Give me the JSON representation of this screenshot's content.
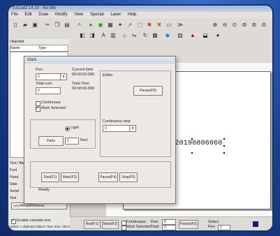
{
  "window": {
    "title": "EzCad2.14.10 - No title"
  },
  "menu": [
    "File",
    "Edit",
    "Draw",
    "Modify",
    "View",
    "Special",
    "Laser",
    "Help"
  ],
  "left_panel": {
    "header": "Objectlist",
    "col_name": "Name",
    "col_type": "Type",
    "lower_rows": [
      "Text / Barcode",
      "Font",
      "Fixed",
      "Date",
      "Serial",
      "Text"
    ],
    "text_value": "yyyyMMddHHmmss",
    "enable_variable_text": "Enable variable text",
    "status": "Select: 1 object(s) Object: Text, Size: X50.00 Y4.00"
  },
  "dialog": {
    "title": "Mark",
    "pen_label": "Pen",
    "pen_value": "0",
    "total_num_label": "Total num",
    "total_num_value": "0",
    "current_time_label": "Current time",
    "current_time_value": "00:00:00.000",
    "total_time_label": "Total Time",
    "total_time_value": "00:00:00.000",
    "continuous_label": "Continuous",
    "mark_selected_label": "Mark Selected",
    "red_label": "Red",
    "red_value": "",
    "light_label": "Light",
    "parts_label": "Parts",
    "parts_value": "1",
    "editor_label": "Editor",
    "param_button": "Param(F3)",
    "continuous_step_label": "Continuous step",
    "continuous_step_value": "0",
    "redF1_button": "Red(F1)",
    "markF2_button": "Mark(F2)",
    "pause_button": "Pause(F4)",
    "stop_button": "Stop(F5)",
    "ready_text": "Ready"
  },
  "canvas": {
    "mark_text": "FM20190806060",
    "crosshair": "+"
  },
  "statusbar": {
    "red_button": "Red(F1)",
    "mark_button": "Mark(F2)",
    "continuous_label": "Continuous",
    "mark_selected_label": "Mark Selected",
    "part_label": "Part",
    "total_label": "Total",
    "part_value": "0",
    "total_value": "0",
    "param_button": "Param(F3)",
    "flag_label": "Select",
    "pen_label": "Pen",
    "pen_value": "1"
  },
  "colors": {
    "outer_bg": "#1b3d86",
    "screen_bg": "#d6d3ce",
    "dialog_bg": "#ece9e4"
  }
}
